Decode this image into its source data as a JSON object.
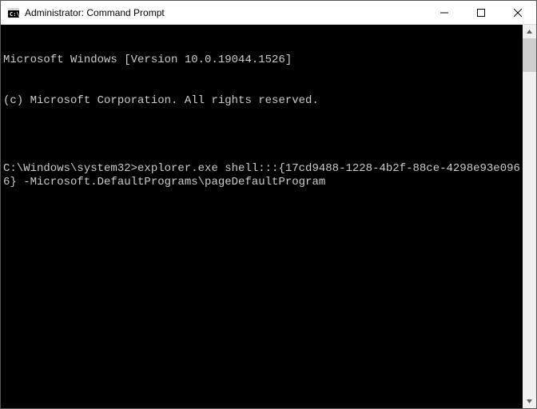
{
  "window": {
    "title": "Administrator: Command Prompt"
  },
  "terminal": {
    "lines": [
      "Microsoft Windows [Version 10.0.19044.1526]",
      "(c) Microsoft Corporation. All rights reserved.",
      "",
      "C:\\Windows\\system32>explorer.exe shell:::{17cd9488-1228-4b2f-88ce-4298e93e0966} -Microsoft.DefaultPrograms\\pageDefaultProgram"
    ]
  },
  "colors": {
    "terminal_bg": "#000000",
    "terminal_fg": "#cccccc",
    "titlebar_bg": "#ffffff"
  }
}
